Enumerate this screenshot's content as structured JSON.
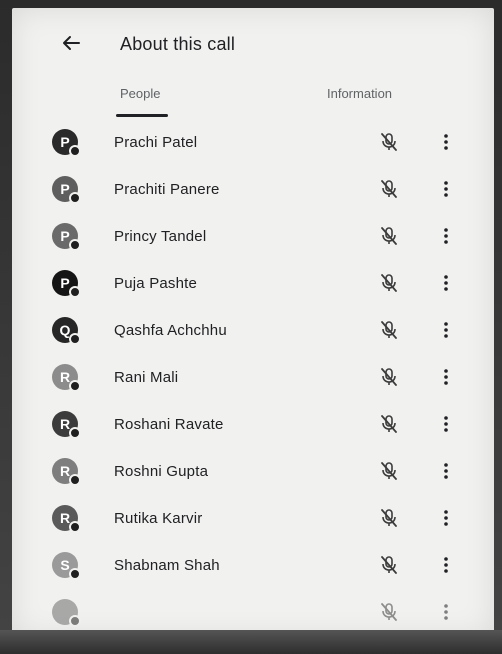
{
  "header": {
    "title": "About this call",
    "back_icon": "arrow-back-icon"
  },
  "tabs": [
    {
      "label": "People",
      "active": true
    },
    {
      "label": "Information",
      "active": false
    }
  ],
  "participants": [
    {
      "name": "Prachi Patel",
      "initial": "P",
      "avatar_color": "#2a2a2a",
      "muted": true
    },
    {
      "name": "Prachiti Panere",
      "initial": "P",
      "avatar_color": "#5e5e5e",
      "muted": true
    },
    {
      "name": "Princy Tandel",
      "initial": "P",
      "avatar_color": "#6a6a6a",
      "muted": true
    },
    {
      "name": "Puja Pashte",
      "initial": "P",
      "avatar_color": "#151515",
      "muted": true
    },
    {
      "name": "Qashfa Achchhu",
      "initial": "Q",
      "avatar_color": "#262626",
      "muted": true
    },
    {
      "name": "Rani Mali",
      "initial": "R",
      "avatar_color": "#8c8c8c",
      "muted": true
    },
    {
      "name": "Roshani Ravate",
      "initial": "R",
      "avatar_color": "#3c3c3c",
      "muted": true
    },
    {
      "name": "Roshni Gupta",
      "initial": "R",
      "avatar_color": "#7e7e7e",
      "muted": true
    },
    {
      "name": "Rutika Karvir",
      "initial": "R",
      "avatar_color": "#5a5a5a",
      "muted": true
    },
    {
      "name": "Shabnam Shah",
      "initial": "S",
      "avatar_color": "#9a9a9a",
      "muted": true
    }
  ],
  "colors": {
    "screen_bg": "#f1f1ef",
    "text_primary": "#202124",
    "text_secondary": "#5f6368"
  }
}
